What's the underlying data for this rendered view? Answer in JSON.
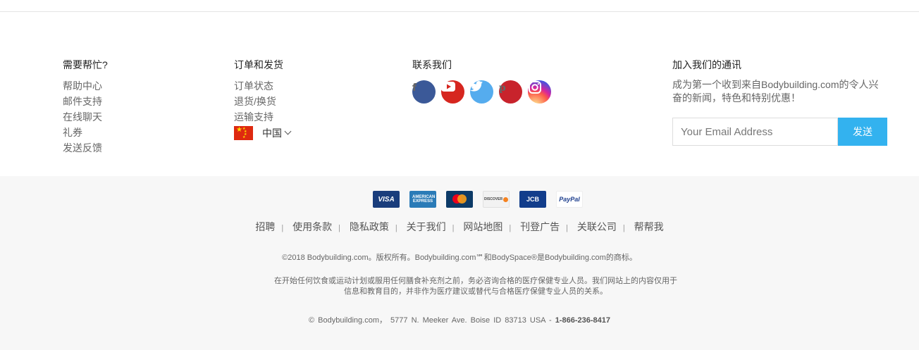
{
  "help": {
    "title": "需要帮忙?",
    "links": [
      "帮助中心",
      "邮件支持",
      "在线聊天",
      "礼券",
      "发送反馈"
    ]
  },
  "orders": {
    "title": "订单和发货",
    "links": [
      "订单状态",
      "退货/换货",
      "运输支持"
    ],
    "country": "中国"
  },
  "contact": {
    "title": "联系我们",
    "social": [
      "facebook-icon",
      "youtube-icon",
      "twitter-icon",
      "pinterest-icon",
      "instagram-icon"
    ]
  },
  "newsletter": {
    "title": "加入我们的通讯",
    "description": "成为第一个收到来自Bodybuilding.com的令人兴奋的新闻，特色和特别优惠！",
    "email_placeholder": "Your Email Address",
    "submit_label": "发送"
  },
  "payments": {
    "visa": "VISA",
    "amex": "AMERICAN EXPRESS",
    "discover": "DISCOVER",
    "jcb": "JCB",
    "paypal": "PayPal"
  },
  "footer_links": [
    "招聘",
    "使用条款",
    "隐私政策",
    "关于我们",
    "网站地图",
    "刊登广告",
    "关联公司",
    "帮帮我"
  ],
  "copyright": "©2018 Bodybuilding.com。版权所有。Bodybuilding.com℠和BodySpace®是Bodybuilding.com的商标。",
  "disclaimer": "在开始任何饮食或运动计划或服用任何膳食补充剂之前，务必咨询合格的医疗保健专业人员。我们网站上的内容仅用于信息和教育目的，并非作为医疗建议或替代与合格医疗保健专业人员的关系。",
  "address": {
    "text": "© Bodybuilding.com， 5777 N. Meeker Ave.  Boise ID  83713  USA - ",
    "phone": "1-866-236-8417"
  },
  "colors": {
    "accent": "#33b2ef",
    "bottom_bg": "#f7f7f7"
  }
}
